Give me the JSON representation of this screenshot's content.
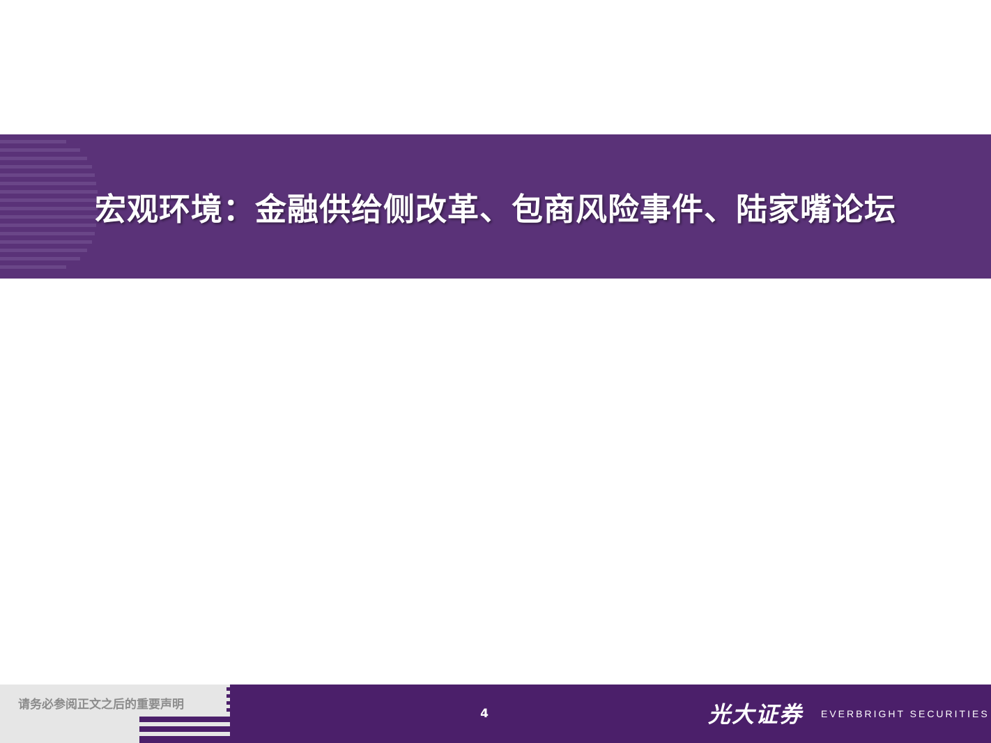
{
  "slide": {
    "title": "宏观环境：金融供给侧改革、包商风险事件、陆家嘴论坛"
  },
  "footer": {
    "disclaimer": "请务必参阅正文之后的重要声明",
    "page_number": "4",
    "logo_cn": "光大证券",
    "logo_en": "EVERBRIGHT SECURITIES"
  },
  "colors": {
    "banner": "#5a3278",
    "footer": "#4b1f6a",
    "footer_gray": "#e6e6e6"
  }
}
